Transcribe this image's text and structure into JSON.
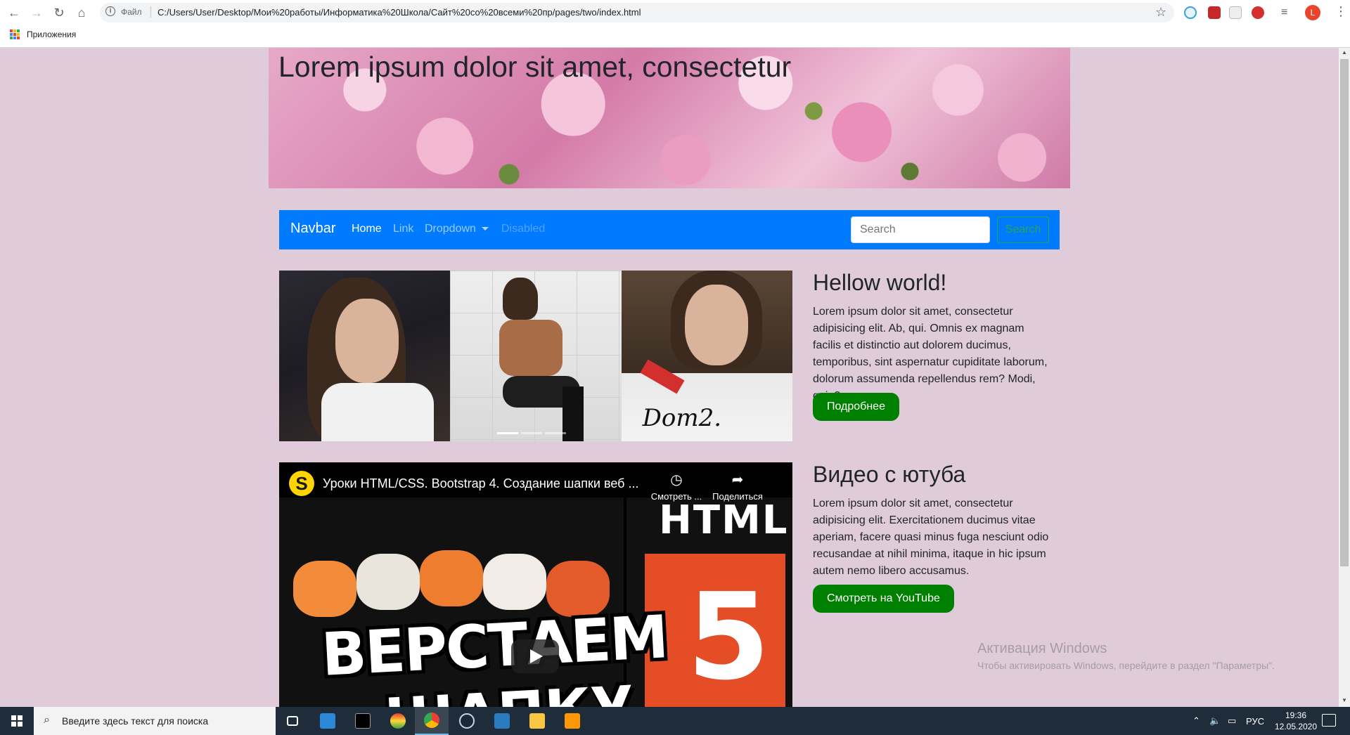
{
  "browser": {
    "url_scheme_label": "Файл",
    "url": "C:/Users/User/Desktop/Мои%20работы/Информатика%20Школа/Сайт%20со%20всеми%20пр/pages/two/index.html",
    "bookmarks_apps_label": "Приложения",
    "profile_initial": "L"
  },
  "header": {
    "title": "Lorem ipsum dolor sit amet, consectetur"
  },
  "navbar": {
    "brand": "Navbar",
    "links": [
      "Home",
      "Link",
      "Dropdown",
      "Disabled"
    ],
    "search_placeholder": "Search",
    "search_button": "Search"
  },
  "section1": {
    "heading": "Hellow world!",
    "text": "Lorem ipsum dolor sit amet, consectetur adipisicing elit. Ab, qui. Omnis ex magnam facilis et distinctio aut dolorem ducimus, temporibus, sint aspernatur cupiditate laborum, dolorum assumenda repellendus rem? Modi, quia?",
    "button": "Подробнее",
    "carousel_logo_text": "Dom2."
  },
  "section2": {
    "heading": "Видео с ютуба",
    "text": "Lorem ipsum dolor sit amet, consectetur adipisicing elit. Exercitationem ducimus vitae aperiam, facere quasi minus fuga nesciunt odio recusandae at nihil minima, itaque in hic ipsum autem nemo libero accusamus.",
    "button": "Смотреть на YouTube",
    "video": {
      "channel_letter": "S",
      "title": "Уроки HTML/CSS. Bootstrap 4. Создание шапки веб ...",
      "watch_later": "Смотреть ...",
      "share": "Поделиться",
      "overlay_html": "HTML",
      "overlay_five": "5",
      "overlay_line1": "ВЕРСТАЕМ",
      "overlay_line2": "ШАПКУ"
    }
  },
  "windows_activation": {
    "title": "Активация Windows",
    "subtitle": "Чтобы активировать Windows, перейдите в раздел \"Параметры\"."
  },
  "taskbar": {
    "search_placeholder": "Введите здесь текст для поиска",
    "language": "РУС",
    "time": "19:36",
    "date": "12.05.2020"
  }
}
